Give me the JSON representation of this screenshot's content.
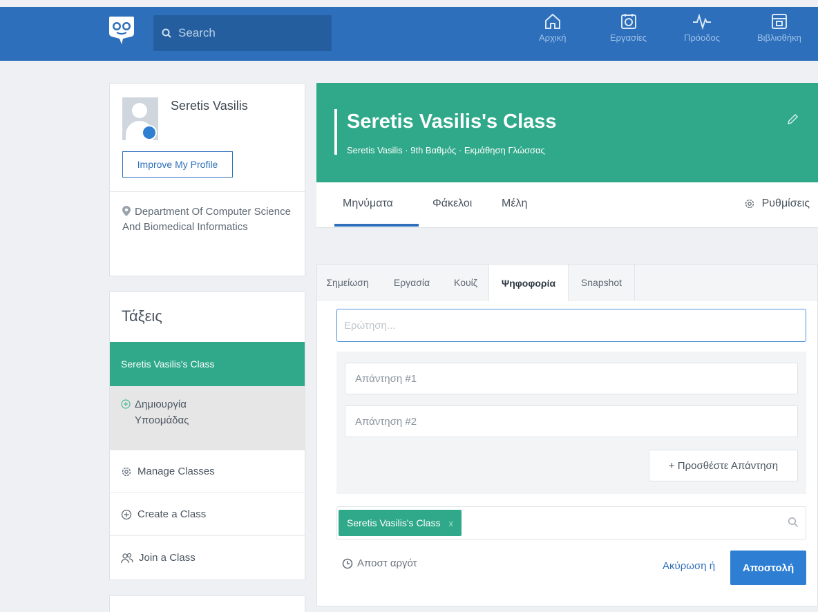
{
  "header": {
    "search_placeholder": "Search",
    "nav": [
      {
        "label": "Αρχική",
        "icon": "home-icon"
      },
      {
        "label": "Εργασίες",
        "icon": "assignments-icon"
      },
      {
        "label": "Πρόοδος",
        "icon": "progress-icon"
      },
      {
        "label": "Βιβλιοθήκη",
        "icon": "library-icon"
      }
    ]
  },
  "profile": {
    "name": "Seretis Vasilis",
    "improve_label": "Improve My Profile",
    "department": "Department Of Computer Science And Biomedical Informatics"
  },
  "classes": {
    "title": "Τάξεις",
    "active_class": "Seretis Vasilis's Class",
    "create_subgroup": "Δημιουργία Υποομάδας",
    "manage": "Manage Classes",
    "create": "Create a Class",
    "join": "Join a Class"
  },
  "class_header": {
    "title": "Seretis Vasilis's Class",
    "subtitle": "Seretis Vasilis · 9th Βαθμός · Εκμάθηση Γλώσσας"
  },
  "main_tabs": {
    "messages": "Μηνύματα",
    "folders": "Φάκελοι",
    "members": "Μέλη",
    "settings": "Ρυθμίσεις"
  },
  "composer": {
    "tabs": [
      "Σημείωση",
      "Εργασία",
      "Κουίζ",
      "Ψηφοφορία",
      "Snapshot"
    ],
    "active_tab": "Ψηφοφορία",
    "question_placeholder": "Ερώτηση...",
    "answer1_placeholder": "Απάντηση #1",
    "answer2_placeholder": "Απάντηση #2",
    "add_answer": "+ Προσθέστε Απάντηση",
    "recipient": "Seretis Vasilis's Class",
    "recipient_remove": "x",
    "send_later": "Αποστ αργότ",
    "cancel": "Ακύρωση ή",
    "send": "Αποστολή"
  },
  "colors": {
    "brand_blue": "#2e6fbb",
    "teal": "#2fa98a"
  }
}
